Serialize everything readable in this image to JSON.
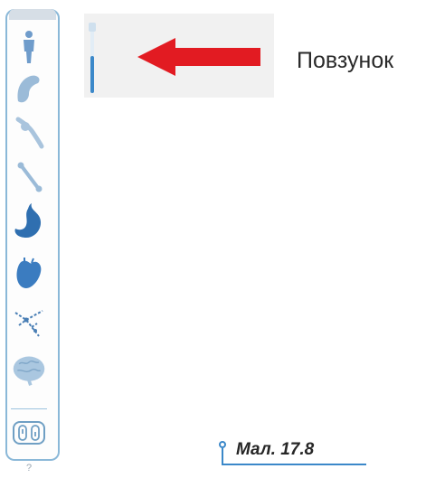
{
  "toolbar": {
    "tools": [
      {
        "name": "body-icon"
      },
      {
        "name": "skin-icon"
      },
      {
        "name": "muscle-icon"
      },
      {
        "name": "bone-icon"
      },
      {
        "name": "stomach-icon"
      },
      {
        "name": "heart-icon"
      },
      {
        "name": "nerves-icon"
      },
      {
        "name": "brain-icon"
      }
    ],
    "help_label": "?"
  },
  "slider_label": "Повзунок",
  "slider_value": 0.52,
  "figure_caption": "Мал. 17.8",
  "colors": {
    "accent": "#3b88c9",
    "arrow": "#e21b22",
    "tool_icon": "#4a7fb5",
    "toolbar_border": "#8ab8d8"
  }
}
